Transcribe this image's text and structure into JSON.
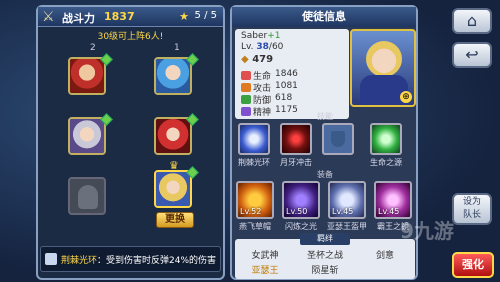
{
  "left_panel": {
    "power_label": "战斗力",
    "power_value": "1837",
    "slot_count": "5 / 5",
    "hint": "30级可上阵6人!",
    "col1": "2",
    "col2": "1",
    "swap_label": "更换",
    "skill_name": "荆棘光环",
    "skill_desc": "：受到伤害时反弹24%的伤害"
  },
  "right_panel": {
    "title": "使徒信息",
    "name": "Saber",
    "name_plus": "+1",
    "level_label": "Lv.",
    "level": "38",
    "level_max": "/60",
    "cost": "479",
    "stats": [
      {
        "label": "生命",
        "value": "1846",
        "color": "#e05050"
      },
      {
        "label": "攻击",
        "value": "1081",
        "color": "#e07a20"
      },
      {
        "label": "防御",
        "value": "618",
        "color": "#3aa040"
      },
      {
        "label": "精神",
        "value": "1175",
        "color": "#8050d0"
      }
    ],
    "skills_header": "技能",
    "skills": [
      "荆棘光环",
      "月牙冲击",
      "",
      "生命之源"
    ],
    "equip_header": "装备",
    "equips": [
      {
        "lv": "Lv.52",
        "name": "燕飞草帽"
      },
      {
        "lv": "Lv.50",
        "name": "闪炼之光"
      },
      {
        "lv": "Lv.45",
        "name": "亚瑟王盔甲"
      },
      {
        "lv": "Lv.45",
        "name": "霸王之镜"
      }
    ],
    "bond_header": "羁绊",
    "bonds": [
      "女武神",
      "圣杯之战",
      "剑意",
      "亚瑟王",
      "陨星斩"
    ]
  },
  "side": {
    "set_leader_1": "设为",
    "set_leader_2": "队长",
    "enhance": "强化"
  },
  "watermark": "九游"
}
